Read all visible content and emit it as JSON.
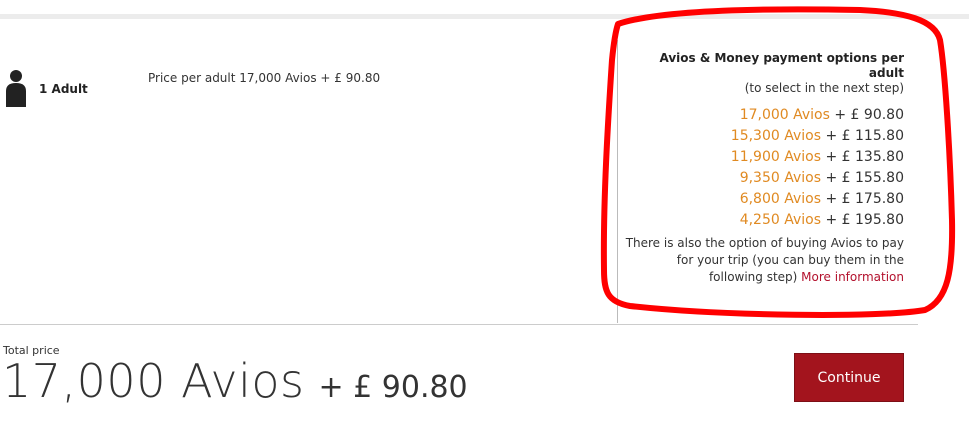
{
  "passenger": {
    "icon": "person-icon",
    "label": "1 Adult"
  },
  "price_per_adult": "Price per adult 17,000 Avios + £ 90.80",
  "options": {
    "title": "Avios & Money payment options per adult",
    "subtitle": "(to select in the next step)",
    "items": [
      {
        "avios": "17,000 Avios",
        "money": " + £ 90.80"
      },
      {
        "avios": "15,300 Avios",
        "money": " + £ 115.80"
      },
      {
        "avios": "11,900 Avios",
        "money": " + £ 135.80"
      },
      {
        "avios": "9,350 Avios",
        "money": " + £ 155.80"
      },
      {
        "avios": "6,800 Avios",
        "money": " + £ 175.80"
      },
      {
        "avios": "4,250 Avios",
        "money": " + £ 195.80"
      }
    ],
    "note": "There is also the option of buying Avios to pay for your trip (you can buy them in the following step) ",
    "more_link": "More information"
  },
  "total": {
    "label": "Total price",
    "avios": "17,000 Avios",
    "money": "+ £ 90.80"
  },
  "continue_label": "Continue",
  "colors": {
    "avios_accent": "#e08a22",
    "link": "#b3112d",
    "button": "#a3141d",
    "highlight_ring": "#ff0000"
  }
}
